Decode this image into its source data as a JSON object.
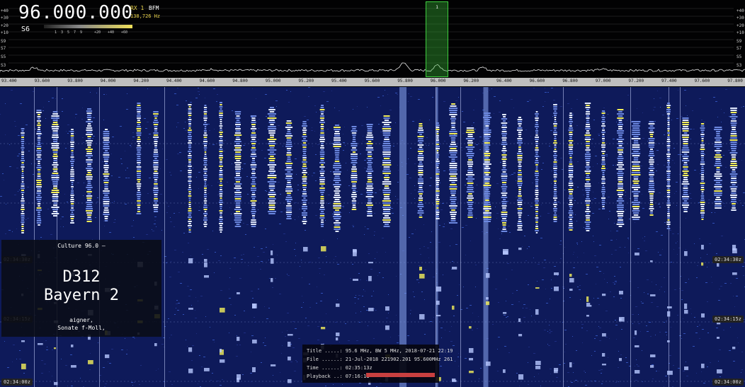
{
  "receiver": {
    "frequency": "96.000.000",
    "rx": "RX 1",
    "mode": "BFM",
    "bandwidth": "138,726 Hz",
    "s_meter": "S6",
    "smeter_scale": [
      "1",
      "3",
      "5",
      "7",
      "9",
      "+20",
      "+40",
      "+60"
    ],
    "db_left": [
      "+40",
      "+30",
      "+20",
      "+10",
      "S9",
      "S7",
      "S5",
      "S3"
    ],
    "db_right": [
      "+40",
      "+30",
      "+20",
      "+10",
      "S9",
      "S7",
      "S5",
      "S3"
    ],
    "vfo_label": "1"
  },
  "axis": {
    "ticks": [
      "93.400",
      "93.600",
      "93.800",
      "94.000",
      "94.200",
      "94.400",
      "94.600",
      "94.800",
      "95.000",
      "95.200",
      "95.400",
      "95.600",
      "95.800",
      "96.000",
      "96.200",
      "96.400",
      "96.600",
      "96.800",
      "97.000",
      "97.200",
      "97.400",
      "97.600",
      "97.800"
    ]
  },
  "waterfall": {
    "time_tags": [
      "02:34:30z",
      "02:34:15z",
      "02:34:00z"
    ]
  },
  "rds": {
    "ps_line": "Culture   96.0   –",
    "pi_code": "D312",
    "station_name": "Bayern 2",
    "radiotext_1": "aigner,",
    "radiotext_2": "Sonate f-Moll,"
  },
  "recording": {
    "title": "Title .....: 95.6 MHz, BW 5 MHz, 2018-07-21 22:19",
    "file": "File ......: 21-Jul-2018 221902.201 95.600MHz 261",
    "time": "Time ......: 02:35:13z",
    "playback": "Playback ..: 07:16:11"
  },
  "colors": {
    "waterfall_bg": "#0e1a5a",
    "signal_peak": "#f5f05a",
    "vfo_green": "#3fcf3f",
    "playback_bar": "#c84040"
  }
}
